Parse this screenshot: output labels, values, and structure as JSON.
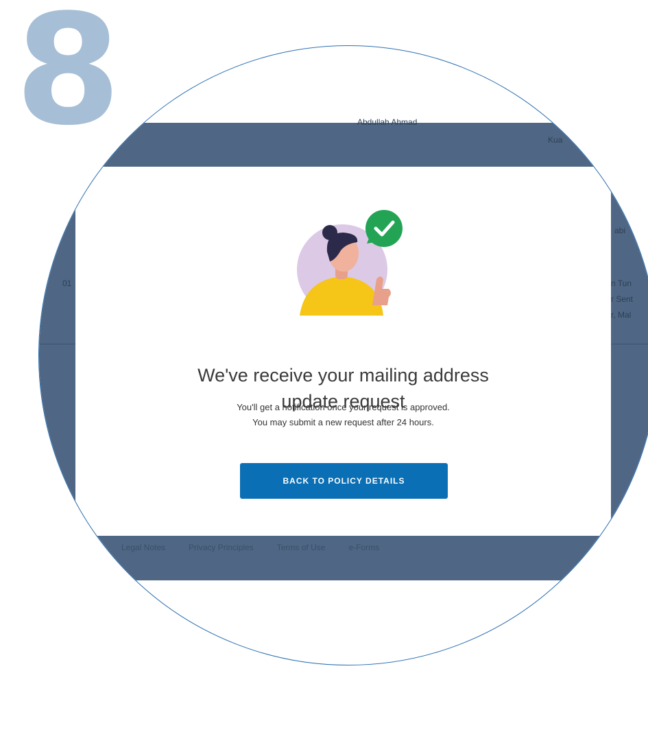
{
  "step": {
    "number": "8"
  },
  "background": {
    "snippets": [
      {
        "text": "Abdullah Ahmad"
      },
      {
        "text": "Kua"
      },
      {
        "text": "01"
      },
      {
        "text": "n Tun"
      },
      {
        "text": "r Sent"
      },
      {
        "text": "r, Mal"
      },
      {
        "text": "abi"
      }
    ],
    "footer_links": [
      "Legal Notes",
      "Privacy Principles",
      "Terms of Use",
      "e-Forms"
    ]
  },
  "modal": {
    "title_line1": "We've receive your mailing address",
    "title_line2": "update request",
    "body_line1": "You'll get a notification once your request is approved.",
    "body_line2": "You may submit a new request after 24 hours.",
    "button_label": "BACK TO POLICY DETAILS"
  },
  "colors": {
    "step_number": "#a6bfd6",
    "overlay": "#4f6784",
    "button": "#0a6fb4",
    "check_badge": "#23a455",
    "avatar_circle": "#dcc9e6",
    "shirt": "#f5c518"
  },
  "icons": {
    "illustration": "woman-thumbs-up-illustration",
    "badge": "check-icon"
  }
}
